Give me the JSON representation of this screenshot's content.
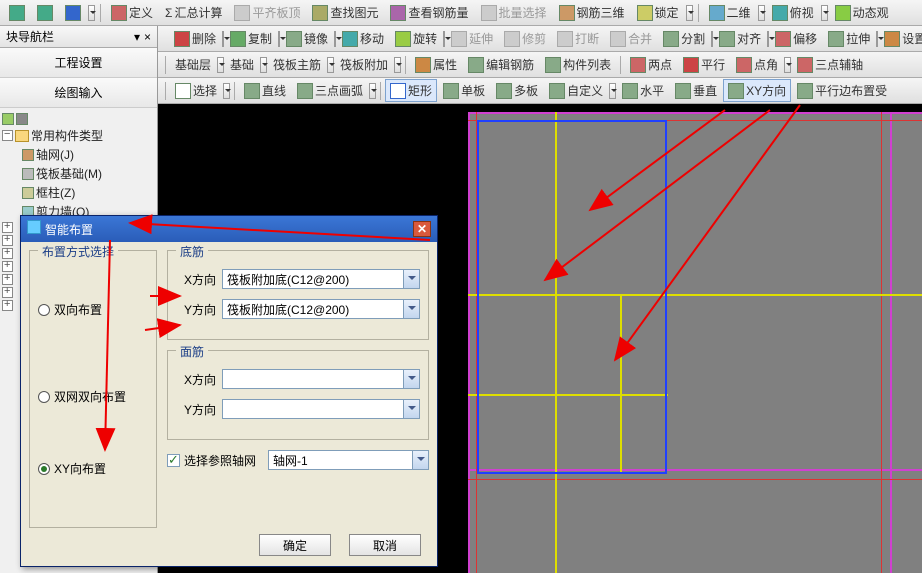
{
  "top_toolbar": {
    "define": "定义",
    "sum": "汇总计算",
    "flatten": "平齐板顶",
    "find": "查找图元",
    "viewbar": "查看钢筋量",
    "batch": "批量选择",
    "bar3d": "钢筋三维",
    "lock": "锁定",
    "two_d": "二维",
    "persp": "俯视",
    "dynamic": "动态观"
  },
  "nav": {
    "title": "块导航栏",
    "tab1": "工程设置",
    "tab2": "绘图输入"
  },
  "tree": {
    "root": "常用构件类型",
    "items": [
      "轴网(J)",
      "筏板基础(M)",
      "框柱(Z)",
      "剪力墙(Q)"
    ]
  },
  "tb2": {
    "del": "删除",
    "copy": "复制",
    "mirror": "镜像",
    "move": "移动",
    "rotate": "旋转",
    "extend": "延伸",
    "trim": "修剪",
    "break": "打断",
    "merge": "合并",
    "split": "分割",
    "align": "对齐",
    "offset": "偏移",
    "stretch": "拉伸",
    "sett": "设置"
  },
  "tb3": {
    "floor": "基础层",
    "base": "基础",
    "main": "筏板主筋",
    "addl": "筏板附加",
    "prop": "属性",
    "editbar": "编辑钢筋",
    "list": "构件列表",
    "two": "两点",
    "para": "平行",
    "angle": "点角",
    "aux": "三点辅轴"
  },
  "tb4": {
    "select": "选择",
    "line": "直线",
    "arc": "三点画弧",
    "rect": "矩形",
    "single": "单板",
    "multi": "多板",
    "custom": "自定义",
    "horiz": "水平",
    "vert": "垂直",
    "xy": "XY方向",
    "paraedge": "平行边布置受"
  },
  "dialog": {
    "title": "智能布置",
    "mode_group": "布置方式选择",
    "r1": "双向布置",
    "r2": "双网双向布置",
    "r3": "XY向布置",
    "bottom_group": "底筋",
    "top_group": "面筋",
    "xdir": "X方向",
    "ydir": "Y方向",
    "combo_val": "筏板附加底(C12@200)",
    "chk": "选择参照轴网",
    "grid_val": "轴网-1",
    "ok": "确定",
    "cancel": "取消"
  }
}
